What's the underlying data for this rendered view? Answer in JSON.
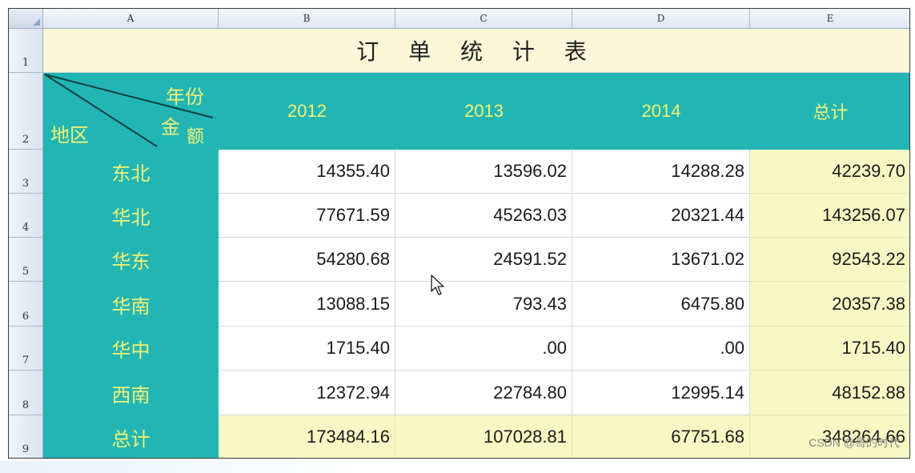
{
  "spreadsheet": {
    "columns": [
      "A",
      "B",
      "C",
      "D",
      "E"
    ],
    "rows": [
      "1",
      "2",
      "3",
      "4",
      "5",
      "6",
      "7",
      "8",
      "9"
    ],
    "title": "订 单 统 计 表",
    "diagonal_header": {
      "top": "年份",
      "middle_a": "金",
      "middle_b": "额",
      "bottom": "地区"
    },
    "year_headers": [
      "2012",
      "2013",
      "2014",
      "总计"
    ],
    "data_rows": [
      {
        "region": "东北",
        "values": [
          "14355.40",
          "13596.02",
          "14288.28",
          "42239.70"
        ]
      },
      {
        "region": "华北",
        "values": [
          "77671.59",
          "45263.03",
          "20321.44",
          "143256.07"
        ]
      },
      {
        "region": "华东",
        "values": [
          "54280.68",
          "24591.52",
          "13671.02",
          "92543.22"
        ]
      },
      {
        "region": "华南",
        "values": [
          "13088.15",
          "793.43",
          "6475.80",
          "20357.38"
        ]
      },
      {
        "region": "华中",
        "values": [
          "1715.40",
          ".00",
          ".00",
          "1715.40"
        ]
      },
      {
        "region": "西南",
        "values": [
          "12372.94",
          "22784.80",
          "12995.14",
          "48152.88"
        ]
      }
    ],
    "total_row": {
      "label": "总计",
      "values": [
        "173484.16",
        "107028.81",
        "67751.68",
        "348264.66"
      ]
    }
  },
  "colors": {
    "teal": "#21b6b3",
    "header_text": "#f4f276",
    "title_bg": "#fdf6d9",
    "total_bg": "#f8f8c4"
  },
  "watermark": "CSDN @哥的时代"
}
